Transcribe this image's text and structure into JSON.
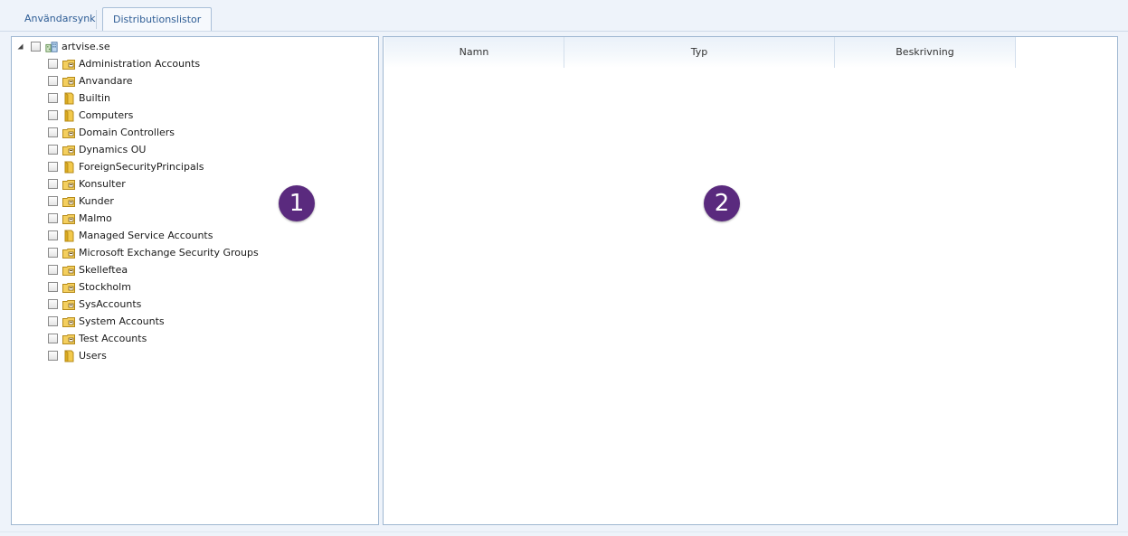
{
  "tabs": [
    {
      "label": "Användarsynk",
      "active": false
    },
    {
      "label": "Distributionslistor",
      "active": true
    }
  ],
  "tree": {
    "root": {
      "label": "artvise.se",
      "icon": "domain-icon",
      "expanded": true,
      "checked": false
    },
    "children": [
      {
        "label": "Administration Accounts",
        "icon": "ou-folder-icon",
        "checked": false
      },
      {
        "label": "Anvandare",
        "icon": "ou-folder-icon",
        "checked": false
      },
      {
        "label": "Builtin",
        "icon": "container-folder-icon",
        "checked": false
      },
      {
        "label": "Computers",
        "icon": "container-folder-icon",
        "checked": false
      },
      {
        "label": "Domain Controllers",
        "icon": "ou-folder-icon",
        "checked": false
      },
      {
        "label": "Dynamics OU",
        "icon": "ou-folder-icon",
        "checked": false
      },
      {
        "label": "ForeignSecurityPrincipals",
        "icon": "container-folder-icon",
        "checked": false
      },
      {
        "label": "Konsulter",
        "icon": "ou-folder-icon",
        "checked": false
      },
      {
        "label": "Kunder",
        "icon": "ou-folder-icon",
        "checked": false
      },
      {
        "label": "Malmo",
        "icon": "ou-folder-icon",
        "checked": false
      },
      {
        "label": "Managed Service Accounts",
        "icon": "container-folder-icon",
        "checked": false
      },
      {
        "label": "Microsoft Exchange Security Groups",
        "icon": "ou-folder-icon",
        "checked": false
      },
      {
        "label": "Skelleftea",
        "icon": "ou-folder-icon",
        "checked": false
      },
      {
        "label": "Stockholm",
        "icon": "ou-folder-icon",
        "checked": false
      },
      {
        "label": "SysAccounts",
        "icon": "ou-folder-icon",
        "checked": false
      },
      {
        "label": "System Accounts",
        "icon": "ou-folder-icon",
        "checked": false
      },
      {
        "label": "Test Accounts",
        "icon": "ou-folder-icon",
        "checked": false
      },
      {
        "label": "Users",
        "icon": "container-folder-icon",
        "checked": false
      }
    ]
  },
  "grid": {
    "columns": [
      "Namn",
      "Typ",
      "Beskrivning"
    ],
    "rows": []
  },
  "callouts": {
    "left": "1",
    "right": "2"
  },
  "colors": {
    "accent": "#2e5d95",
    "callout": "#5a2a7e",
    "border": "#9fb7d1"
  }
}
